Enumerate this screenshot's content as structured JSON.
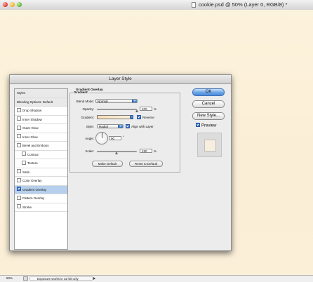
{
  "window": {
    "title": "cookie.psd @ 50% (Layer 0, RGB/8) *"
  },
  "status_bar": {
    "zoom": "50%",
    "message": "Exposure works in 32-bit only"
  },
  "dialog": {
    "title": "Layer Style",
    "styles_list": [
      {
        "label": "Styles",
        "type": "header"
      },
      {
        "label": "Blending Options: Default",
        "type": "header"
      },
      {
        "label": "Drop Shadow",
        "checked": false
      },
      {
        "label": "Inner Shadow",
        "checked": false
      },
      {
        "label": "Outer Glow",
        "checked": false
      },
      {
        "label": "Inner Glow",
        "checked": false
      },
      {
        "label": "Bevel and Emboss",
        "checked": false
      },
      {
        "label": "Contour",
        "checked": false,
        "indent": true
      },
      {
        "label": "Texture",
        "checked": false,
        "indent": true
      },
      {
        "label": "Satin",
        "checked": false
      },
      {
        "label": "Color Overlay",
        "checked": false
      },
      {
        "label": "Gradient Overlay",
        "checked": true,
        "selected": true
      },
      {
        "label": "Pattern Overlay",
        "checked": false
      },
      {
        "label": "Stroke",
        "checked": false
      }
    ],
    "gradient_overlay": {
      "section_title": "Gradient Overlay",
      "group_title": "Gradient",
      "blend_mode_label": "Blend Mode:",
      "blend_mode_value": "Normal",
      "opacity_label": "Opacity:",
      "opacity_value": "100",
      "opacity_unit": "%",
      "opacity_level": 1.0,
      "gradient_label": "Gradient:",
      "gradient_colors": [
        "#f7ddb6",
        "#fcf1dc"
      ],
      "reverse_label": "Reverse",
      "reverse_checked": true,
      "style_label": "Style:",
      "style_value": "Radial",
      "align_label": "Align with Layer",
      "align_checked": true,
      "angle_label": "Angle:",
      "angle_value": "90",
      "angle_unit": "°",
      "scale_label": "Scale:",
      "scale_value": "150",
      "scale_unit": "%",
      "scale_level": 0.5,
      "make_default_label": "Make Default",
      "reset_default_label": "Reset to Default"
    },
    "buttons": {
      "ok": "OK",
      "cancel": "Cancel",
      "new_style": "New Style..."
    },
    "preview": {
      "label": "Preview",
      "checked": true,
      "swatch_color": "#f8eedf"
    }
  }
}
